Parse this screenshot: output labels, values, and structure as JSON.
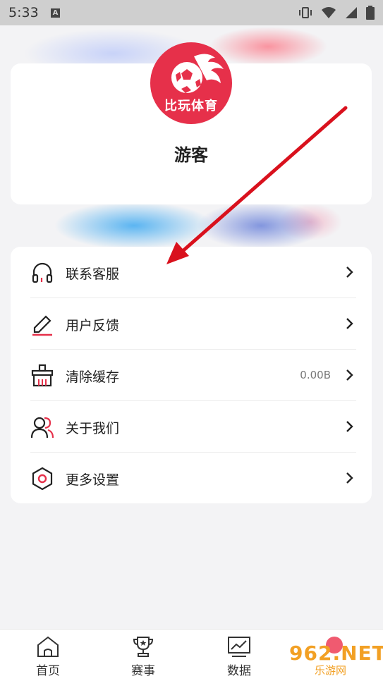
{
  "status_bar": {
    "time": "5:33",
    "a_indicator": "A"
  },
  "profile": {
    "logo_text": "比玩体育",
    "username": "游客"
  },
  "menu": [
    {
      "label": "联系客服",
      "icon": "headset-icon",
      "value": ""
    },
    {
      "label": "用户反馈",
      "icon": "edit-icon",
      "value": ""
    },
    {
      "label": "清除缓存",
      "icon": "broom-icon",
      "value": "0.00B"
    },
    {
      "label": "关于我们",
      "icon": "users-icon",
      "value": ""
    },
    {
      "label": "更多设置",
      "icon": "hexagon-settings-icon",
      "value": ""
    }
  ],
  "tabs": [
    {
      "label": "首页",
      "icon": "home-icon"
    },
    {
      "label": "赛事",
      "icon": "trophy-icon"
    },
    {
      "label": "数据",
      "icon": "chart-icon"
    }
  ],
  "watermark": {
    "main": "962.NET",
    "sub": "乐游网"
  },
  "colors": {
    "accent": "#e6304a",
    "arrow": "#d9111d"
  }
}
